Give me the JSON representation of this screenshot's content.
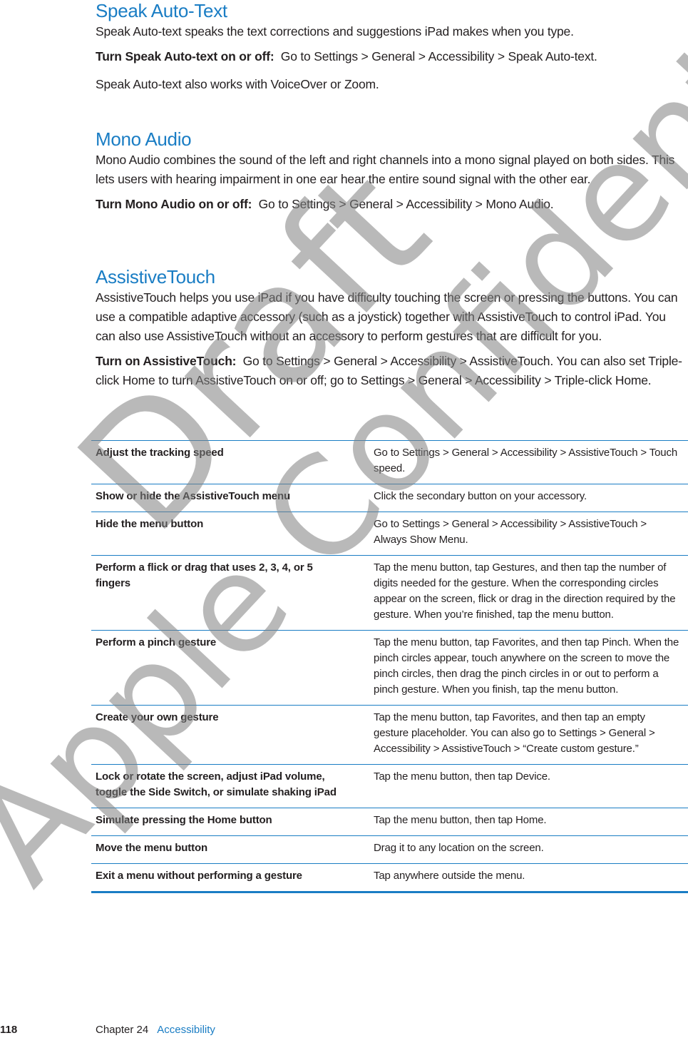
{
  "sections": {
    "speak_auto_text": {
      "heading": "Speak Auto-Text",
      "body": "Speak Auto-text speaks the text corrections and suggestions iPad makes when you type.",
      "instruction_lead": "Turn Speak Auto-text on or off:",
      "instruction_text": "Go to Settings > General > Accessibility > Speak Auto-text.",
      "note": "Speak Auto-text also works with VoiceOver or Zoom."
    },
    "mono_audio": {
      "heading": "Mono Audio",
      "body": "Mono Audio combines the sound of the left and right channels into a mono signal played on both sides. This lets users with hearing impairment in one ear hear the entire sound signal with the other ear.",
      "instruction_lead": "Turn Mono Audio on or off:",
      "instruction_text": "Go to Settings > General > Accessibility > Mono Audio."
    },
    "assistive_touch": {
      "heading": "AssistiveTouch",
      "body": "AssistiveTouch helps you use iPad if you have difficulty touching the screen or pressing the buttons. You can use a compatible adaptive accessory (such as a joystick) together with AssistiveTouch to control iPad. You can also use AssistiveTouch without an accessory to perform gestures that are difficult for you.",
      "instruction_lead": "Turn on AssistiveTouch:",
      "instruction_text": "Go to Settings > General > Accessibility > AssistiveTouch. You can also set Triple-click Home to turn AssistiveTouch on or off; go to Settings > General > Accessibility > Triple-click Home."
    }
  },
  "table": {
    "rows": [
      {
        "task": "Adjust the tracking speed",
        "how": "Go to Settings > General > Accessibility > AssistiveTouch > Touch speed."
      },
      {
        "task": "Show or hide the AssistiveTouch menu",
        "how": "Click the secondary button on your accessory."
      },
      {
        "task": "Hide the menu button",
        "how": "Go to Settings > General > Accessibility > AssistiveTouch > Always Show Menu."
      },
      {
        "task": "Perform a flick or drag that uses 2, 3, 4, or 5 fingers",
        "how": "Tap the menu button, tap Gestures, and then tap the number of digits needed for the gesture. When the corresponding circles appear on the screen, flick or drag in the direction required by the gesture. When you’re finished, tap the menu button."
      },
      {
        "task": "Perform a pinch gesture",
        "how": "Tap the menu button, tap Favorites, and then tap Pinch. When the pinch circles appear, touch anywhere on the screen to move the pinch circles, then drag the pinch circles in or out to perform a pinch gesture. When you finish, tap the menu button."
      },
      {
        "task": "Create your own gesture",
        "how": "Tap the menu button, tap Favorites, and then tap an empty gesture placeholder. You can also go to Settings > General > Accessibility > AssistiveTouch > “Create custom gesture.”"
      },
      {
        "task": "Lock or rotate the screen, adjust iPad volume, toggle the Side Switch, or simulate shaking iPad",
        "how": "Tap the menu button, then tap Device."
      },
      {
        "task": "Simulate pressing the Home button",
        "how": "Tap the menu button, then tap Home."
      },
      {
        "task": "Move the menu button",
        "how": "Drag it to any location on the screen."
      },
      {
        "task": "Exit a menu without performing a gesture",
        "how": "Tap anywhere outside the menu."
      }
    ]
  },
  "footer": {
    "page_number": "118",
    "chapter": "Chapter 24",
    "chapter_title": "Accessibility"
  },
  "watermark": {
    "line1": "Draft",
    "line2": "Apple Confidential"
  },
  "colors": {
    "accent": "#1a7dc4",
    "text": "#231f20",
    "watermark": "#808080"
  }
}
